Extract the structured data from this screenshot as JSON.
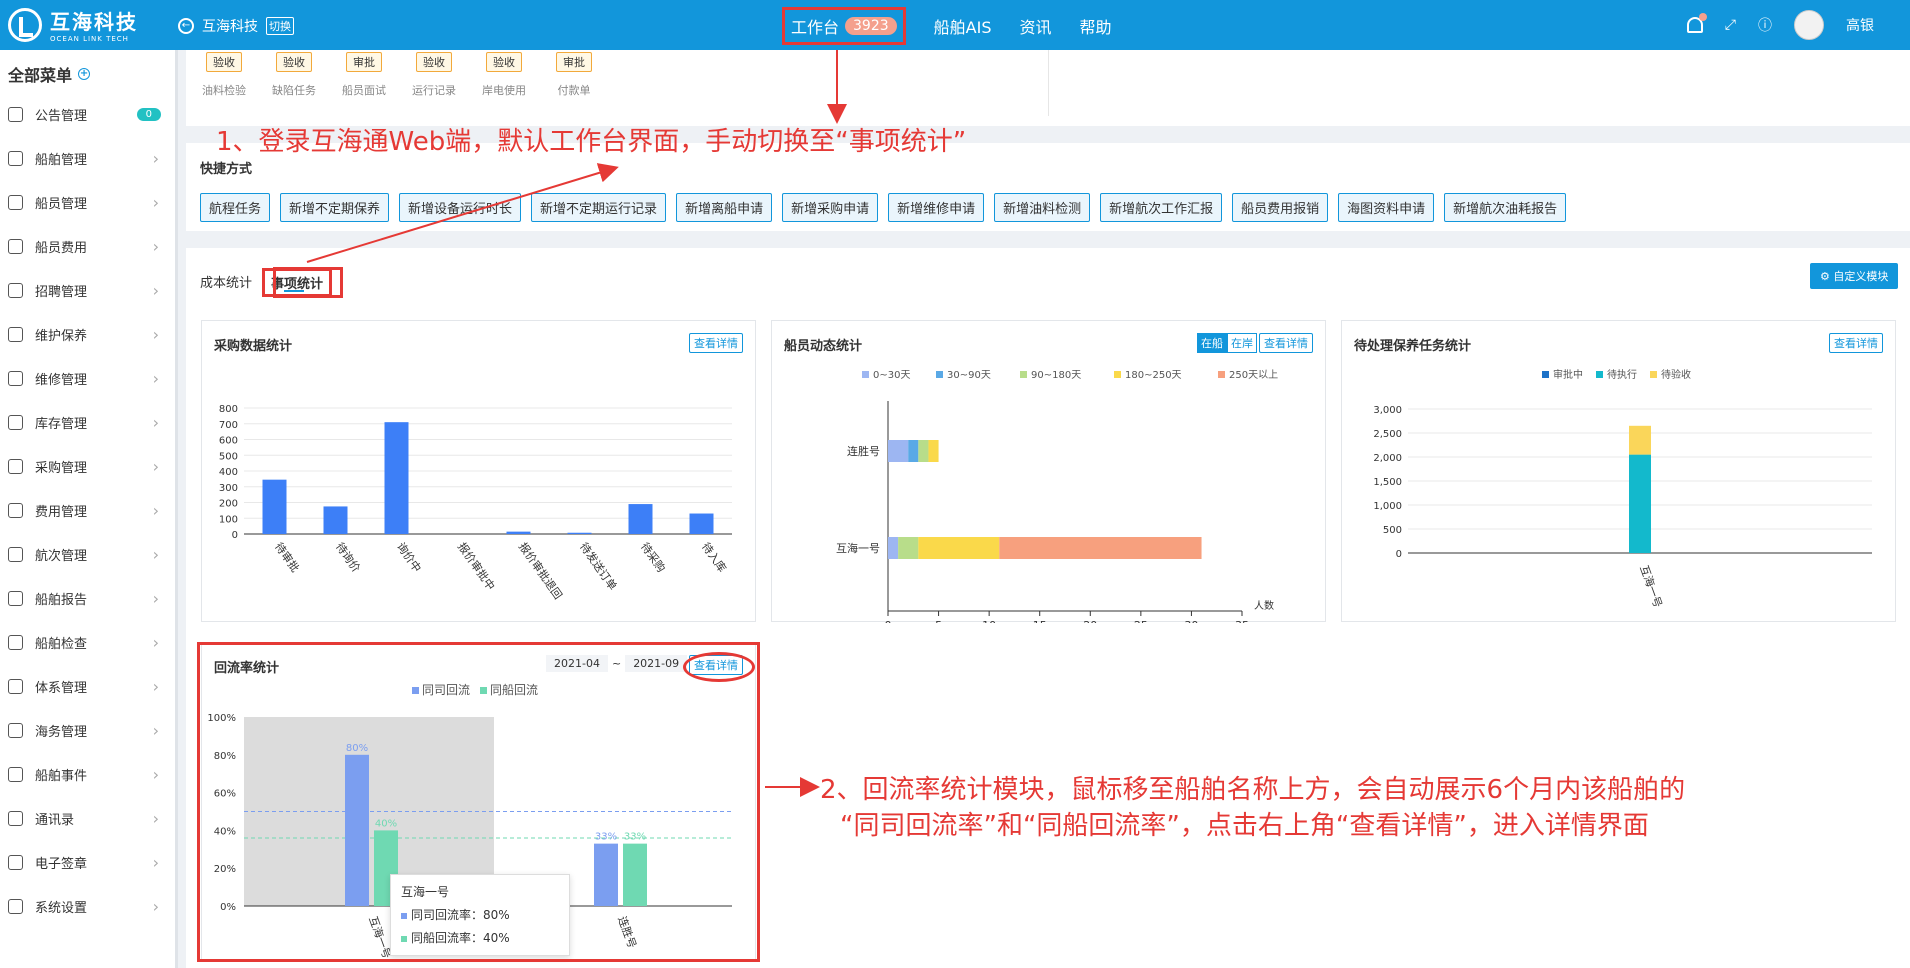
{
  "brand": {
    "cn": "互海科技",
    "en": "OCEAN LINK TECH"
  },
  "header": {
    "company": "互海科技",
    "switch": "切换",
    "nav": [
      {
        "label": "工作台",
        "badge": "3923"
      },
      {
        "label": "船舶AIS"
      },
      {
        "label": "资讯"
      },
      {
        "label": "帮助"
      }
    ],
    "user": "高银"
  },
  "sidebar": {
    "title": "全部菜单",
    "items": [
      {
        "label": "公告管理",
        "count": "0"
      },
      {
        "label": "船舶管理"
      },
      {
        "label": "船员管理"
      },
      {
        "label": "船员费用"
      },
      {
        "label": "招聘管理"
      },
      {
        "label": "维护保养"
      },
      {
        "label": "维修管理"
      },
      {
        "label": "库存管理"
      },
      {
        "label": "采购管理"
      },
      {
        "label": "费用管理"
      },
      {
        "label": "航次管理"
      },
      {
        "label": "船舶报告"
      },
      {
        "label": "船舶检查"
      },
      {
        "label": "体系管理"
      },
      {
        "label": "海务管理"
      },
      {
        "label": "船舶事件"
      },
      {
        "label": "通讯录"
      },
      {
        "label": "电子签章"
      },
      {
        "label": "系统设置"
      }
    ]
  },
  "mini_tasks": [
    {
      "tag": "验收",
      "label": "油料检验"
    },
    {
      "tag": "验收",
      "label": "缺陷任务"
    },
    {
      "tag": "审批",
      "label": "船员面试"
    },
    {
      "tag": "验收",
      "label": "运行记录"
    },
    {
      "tag": "验收",
      "label": "岸电使用"
    },
    {
      "tag": "审批",
      "label": "付款单"
    }
  ],
  "shortcut_title": "快捷方式",
  "shortcuts": [
    "航程任务",
    "新增不定期保养",
    "新增设备运行时长",
    "新增不定期运行记录",
    "新增离船申请",
    "新增采购申请",
    "新增维修申请",
    "新增油料检测",
    "新增航次工作汇报",
    "船员费用报销",
    "海图资料申请",
    "新增航次油耗报告"
  ],
  "tabs": [
    "成本统计",
    "事项统计"
  ],
  "custom_module": "自定义模块",
  "detail_label": "查看详情",
  "cards": {
    "purchase": {
      "title": "采购数据统计"
    },
    "crew": {
      "title": "船员动态统计",
      "toggle": [
        "在船",
        "在岸"
      ]
    },
    "maintenance": {
      "title": "待处理保养任务统计"
    },
    "return_rate": {
      "title": "回流率统计",
      "start": "2021-04",
      "end": "2021-09",
      "tilde": "~"
    }
  },
  "chart_data": [
    {
      "type": "bar",
      "categories": [
        "待审批",
        "待询价",
        "询价中",
        "报价审批中",
        "报价审批退回",
        "待发送订单",
        "待采购",
        "待入库"
      ],
      "values": [
        345,
        175,
        710,
        0,
        15,
        8,
        190,
        130
      ],
      "ylim": [
        0,
        800
      ],
      "yticks": [
        0,
        100,
        200,
        300,
        400,
        500,
        600,
        700,
        800
      ],
      "color": "#3d7ff7"
    },
    {
      "type": "bar",
      "orientation": "horizontal",
      "stacked": true,
      "categories": [
        "连胜号",
        "互海一号"
      ],
      "series": [
        {
          "name": "0~30天",
          "values": [
            2,
            1
          ],
          "color": "#9db6f2"
        },
        {
          "name": "30~90天",
          "values": [
            1,
            0
          ],
          "color": "#5aa9e6"
        },
        {
          "name": "90~180天",
          "values": [
            1,
            2
          ],
          "color": "#b8dd8a"
        },
        {
          "name": "180~250天",
          "values": [
            1,
            8
          ],
          "color": "#fad94a"
        },
        {
          "name": "250天以上",
          "values": [
            0,
            20
          ],
          "color": "#f7a07e"
        }
      ],
      "xlim": [
        0,
        35
      ],
      "xticks": [
        0,
        5,
        10,
        15,
        20,
        25,
        30,
        35
      ],
      "xlabel": "人数"
    },
    {
      "type": "bar",
      "stacked": true,
      "categories": [
        "互海一号"
      ],
      "series": [
        {
          "name": "审批中",
          "values": [
            0
          ],
          "color": "#1d72c8"
        },
        {
          "name": "待执行",
          "values": [
            2050
          ],
          "color": "#13b9cc"
        },
        {
          "name": "待验收",
          "values": [
            600
          ],
          "color": "#fad65a"
        }
      ],
      "ylim": [
        0,
        3000
      ],
      "yticks": [
        "0",
        "500",
        "1,000",
        "1,500",
        "2,000",
        "2,500",
        "3,000"
      ]
    },
    {
      "type": "bar",
      "categories": [
        "互海一号",
        "连胜号"
      ],
      "series": [
        {
          "name": "同司回流",
          "values": [
            80,
            33
          ],
          "color": "#7b9ef0",
          "labels": [
            "80%",
            "33%"
          ]
        },
        {
          "name": "同船回流",
          "values": [
            40,
            33
          ],
          "color": "#6fd9b2",
          "labels": [
            "40%",
            "33%"
          ]
        }
      ],
      "ylim": [
        0,
        100
      ],
      "yticks": [
        "0%",
        "20%",
        "40%",
        "60%",
        "80%",
        "100%"
      ]
    }
  ],
  "tooltip": {
    "title": "互海一号",
    "line1": "同司回流率：80%",
    "line2": "同船回流率：40%"
  },
  "annotations": {
    "a1": "1、登录互海通Web端，默认工作台界面，手动切换至“事项统计”",
    "a2_line1": "2、回流率统计模块，鼠标移至船舶名称上方，会自动展示6个月内该船舶的",
    "a2_line2": "“同司回流率”和“同船回流率”，点击右上角“查看详情”，进入详情界面"
  }
}
